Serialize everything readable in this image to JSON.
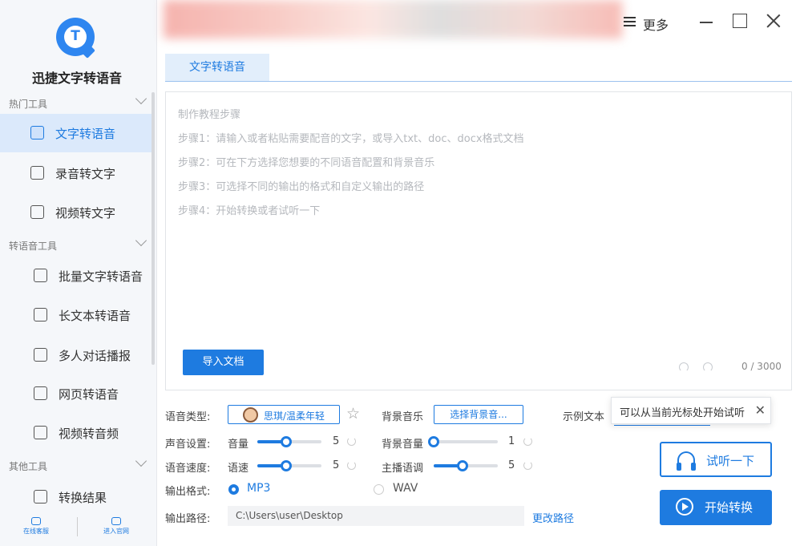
{
  "app": {
    "title": "迅捷文字转语音"
  },
  "sidebar": {
    "groups": [
      {
        "label": "热门工具"
      },
      {
        "label": "转语音工具"
      },
      {
        "label": "其他工具"
      }
    ],
    "items": [
      {
        "label": "文字转语音",
        "icon": "text-to-speech-icon",
        "active": true
      },
      {
        "label": "录音转文字",
        "icon": "recording-to-text-icon"
      },
      {
        "label": "视频转文字",
        "icon": "video-to-text-icon"
      },
      {
        "label": "批量文字转语音",
        "icon": "batch-text-to-speech-icon"
      },
      {
        "label": "长文本转语音",
        "icon": "long-text-to-speech-icon"
      },
      {
        "label": "多人对话播报",
        "icon": "multi-person-dialog-icon"
      },
      {
        "label": "网页转语音",
        "icon": "webpage-to-speech-icon"
      },
      {
        "label": "视频转音频",
        "icon": "video-to-audio-icon"
      },
      {
        "label": "转换结果",
        "icon": "conversion-result-icon"
      }
    ],
    "bottom": {
      "support": "在线客服",
      "website": "进入官网"
    }
  },
  "titlebar": {
    "more": "更多"
  },
  "tabs": [
    {
      "label": "文字转语音"
    }
  ],
  "editor": {
    "hints": [
      "制作教程步骤",
      "步骤1：请输入或者粘贴需要配音的文字，或导入txt、doc、docx格式文档",
      "步骤2：可在下方选择您想要的不同语音配置和背景音乐",
      "步骤3：可选择不同的输出的格式和自定义输出的路径",
      "步骤4：开始转换或者试听一下"
    ],
    "import_label": "导入文档",
    "counter": "0 / 3000"
  },
  "settings": {
    "voice_type_label": "语音类型:",
    "voice_value": "思琪/温柔年轻",
    "bgm_label": "背景音乐",
    "bgm_button": "选择背景音...",
    "sample_label": "示例文本",
    "tooltip": "可以从当前光标处开始试听",
    "sound_label": "声音设置:",
    "volume_label": "音量",
    "volume_value": "5",
    "volume_fraction": 0.45,
    "bg_volume_label": "背景音量",
    "bg_volume_value": "1",
    "bg_volume_fraction": 0.0,
    "speed_section_label": "语音速度:",
    "speed_label": "语速",
    "speed_value": "5",
    "speed_fraction": 0.45,
    "pitch_label": "主播语调",
    "pitch_value": "5",
    "pitch_fraction": 0.45,
    "format_label": "输出格式:",
    "format_options": [
      "MP3",
      "WAV"
    ],
    "format_selected": "MP3",
    "path_label": "输出路径:",
    "path_value": "C:\\Users\\user\\Desktop",
    "change_path": "更改路径"
  },
  "actions": {
    "listen": "试听一下",
    "convert": "开始转换"
  },
  "colors": {
    "accent": "#1e7be0",
    "active_bg": "#dbe9fb"
  }
}
